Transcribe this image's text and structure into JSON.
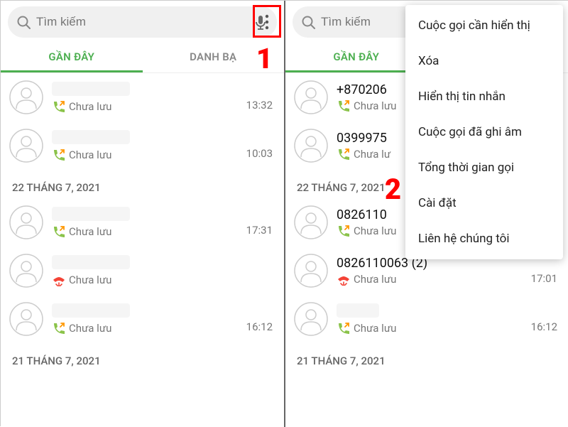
{
  "search": {
    "placeholder": "Tìm kiếm"
  },
  "tabs": {
    "recent": "GẦN ĐÂY",
    "contacts": "DANH BẠ"
  },
  "date_headers": {
    "d1": "22 THÁNG 7, 2021",
    "d2": "21 THÁNG 7, 2021"
  },
  "left": {
    "rows": [
      {
        "sub": "Chưa lưu",
        "time": "13:32",
        "type": "out",
        "blur": true
      },
      {
        "sub": "Chưa lưu",
        "time": "10:03",
        "type": "out",
        "blur": true
      },
      {
        "sub": "Chưa lưu",
        "time": "17:31",
        "type": "out",
        "blur": true
      },
      {
        "sub": "Chưa lưu",
        "time": "",
        "type": "missed",
        "blur": true
      },
      {
        "sub": "Chưa lưu",
        "time": "16:12",
        "type": "out",
        "blur": true
      }
    ]
  },
  "right": {
    "rows": [
      {
        "num": "+870206",
        "sub": "Chưa lưu",
        "time": "",
        "type": "out"
      },
      {
        "num": "0399975",
        "sub": "Chưa lư",
        "time": "",
        "type": "out"
      },
      {
        "num": "0826110",
        "sub": "Chưa lưu",
        "time": "",
        "type": "out"
      },
      {
        "num": "0826110063 (2)",
        "sub": "Chưa lưu",
        "time": "17:01",
        "type": "missed"
      },
      {
        "num": "",
        "sub": "Chưa lưu",
        "time": "16:12",
        "type": "out"
      }
    ]
  },
  "menu": {
    "items": [
      "Cuộc gọi cần hiển thị",
      "Xóa",
      "Hiển thị tin nhắn",
      "Cuộc gọi đã ghi âm",
      "Tổng thời gian gọi",
      "Cài đặt",
      "Liên hệ chúng tôi"
    ]
  },
  "annotations": {
    "step1": "1",
    "step2": "2"
  }
}
